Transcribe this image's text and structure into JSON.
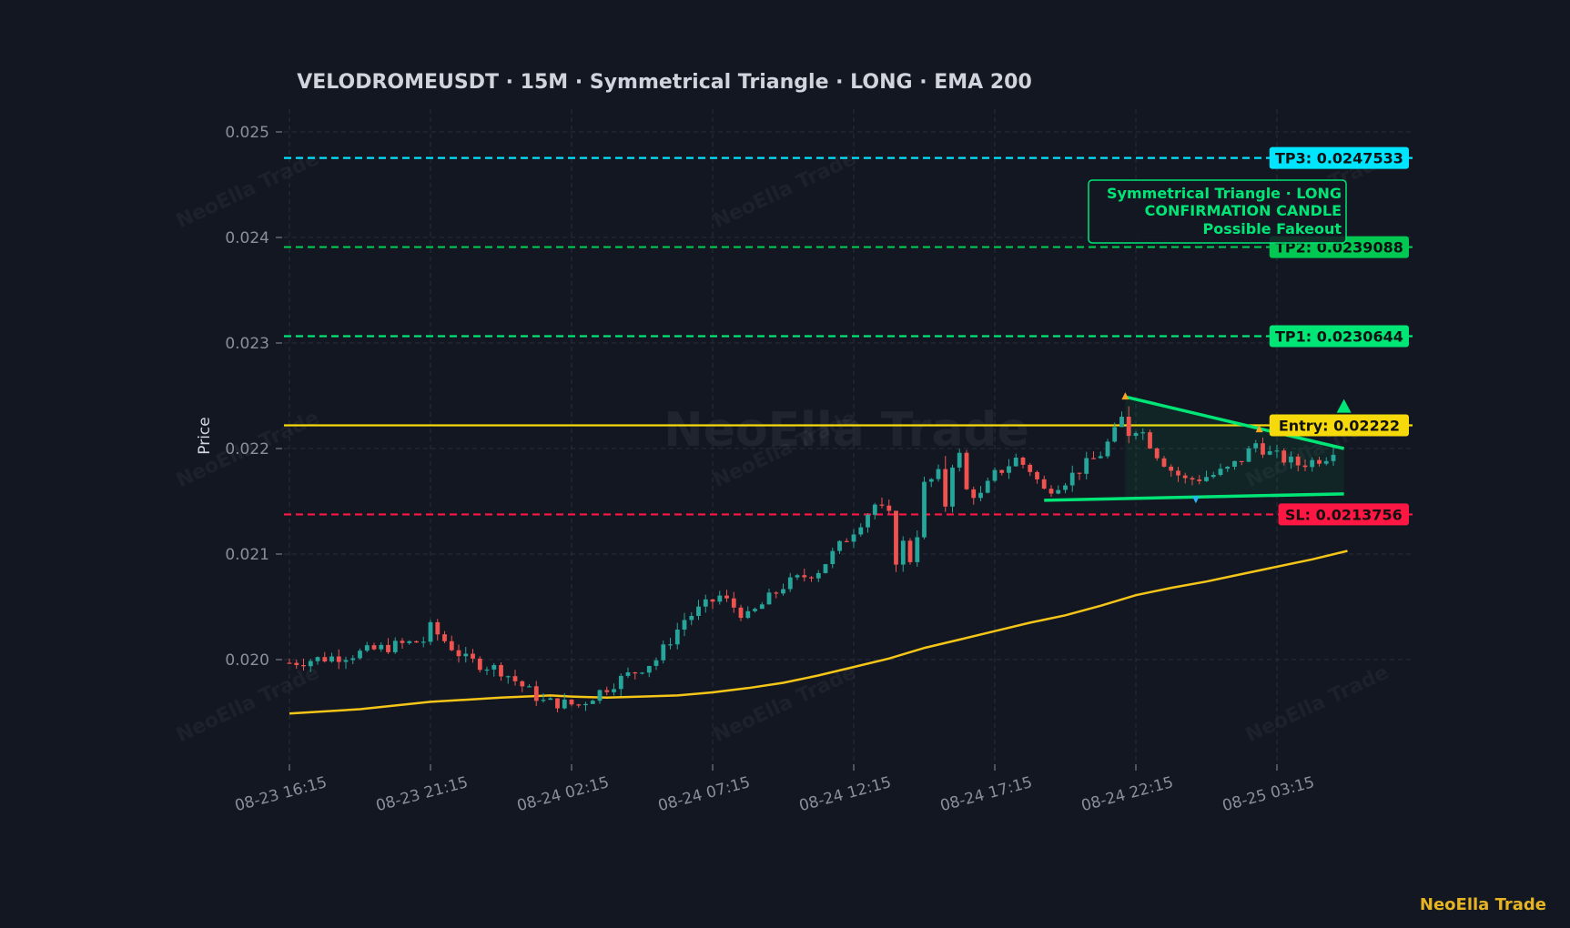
{
  "title": "VELODROMEUSDT  ·  15M  ·  Symmetrical Triangle  ·  LONG  ·  EMA 200",
  "watermark_center": "NeoElla Trade",
  "watermark_small": "NeoElla Trade",
  "brand": "NeoElla Trade",
  "colors": {
    "background": "#131722",
    "grid": "#2a2e39",
    "text": "#d1d4dc",
    "tick_text": "#8a8f9c",
    "candle_up": "#26a69a",
    "candle_down": "#ef5350",
    "ema": "#f5c518",
    "entry": "#f5d90a",
    "sl": "#ff1744",
    "tp1": "#00e676",
    "tp2": "#00c853",
    "tp3": "#00e5ff",
    "triangle": "#00e676",
    "brand": "#e6b422"
  },
  "annotation_lines": [
    "Symmetrical Triangle · LONG",
    "CONFIRMATION CANDLE",
    "Possible Fakeout"
  ],
  "chart_data": {
    "type": "candlestick",
    "title": "VELODROMEUSDT  ·  15M  ·  Symmetrical Triangle  ·  LONG  ·  EMA 200",
    "xlabel": "",
    "ylabel": "Price",
    "ylim": [
      0.0191,
      0.0252
    ],
    "yticks": [
      "0.020",
      "0.021",
      "0.022",
      "0.023",
      "0.024",
      "0.025"
    ],
    "ytick_values": [
      0.02,
      0.021,
      0.022,
      0.023,
      0.024,
      0.025
    ],
    "xticks": [
      "08-23 16:15",
      "08-23 21:15",
      "08-24 02:15",
      "08-24 07:15",
      "08-24 12:15",
      "08-24 17:15",
      "08-24 22:15",
      "08-25 03:15"
    ],
    "xtick_bar_index": [
      0,
      20,
      40,
      60,
      80,
      100,
      120,
      140
    ],
    "bar_count": 150,
    "grid": true,
    "levels": [
      {
        "name": "TP3",
        "label": "TP3: 0.0247533",
        "value": 0.0247533,
        "style": "dashed"
      },
      {
        "name": "TP2",
        "label": "TP2: 0.0239088",
        "value": 0.0239088,
        "style": "dashed"
      },
      {
        "name": "TP1",
        "label": "TP1: 0.0230644",
        "value": 0.0230644,
        "style": "dashed"
      },
      {
        "name": "Entry",
        "label": "Entry: 0.02222",
        "value": 0.02222,
        "style": "solid"
      },
      {
        "name": "SL",
        "label": "SL: 0.0213756",
        "value": 0.0213756,
        "style": "dashed"
      }
    ],
    "triangle": {
      "upper": [
        [
          118.5,
          0.02249
        ],
        [
          149.5,
          0.022
        ]
      ],
      "lower": [
        [
          107,
          0.02151
        ],
        [
          149.5,
          0.02157
        ]
      ],
      "pivot_highs": [
        [
          118.5,
          0.02249
        ],
        [
          137.5,
          0.02218
        ]
      ],
      "pivot_lows": [
        [
          128.5,
          0.02155
        ]
      ],
      "signal_bar": 149.5,
      "signal_price": 0.0224
    },
    "ema200": {
      "name": "EMA 200",
      "x": [
        0,
        10,
        20,
        30,
        37,
        40,
        45,
        50,
        55,
        60,
        65,
        70,
        75,
        80,
        85,
        90,
        95,
        100,
        105,
        110,
        115,
        120,
        125,
        130,
        135,
        140,
        145,
        150
      ],
      "y": [
        0.01949,
        0.01953,
        0.0196,
        0.01964,
        0.01966,
        0.01965,
        0.01964,
        0.01965,
        0.01966,
        0.01969,
        0.01973,
        0.01978,
        0.01985,
        0.01993,
        0.02001,
        0.02011,
        0.02019,
        0.02027,
        0.02035,
        0.02042,
        0.02051,
        0.02061,
        0.02068,
        0.02074,
        0.02081,
        0.02088,
        0.02095,
        0.02103
      ]
    },
    "anchors": [
      [
        0,
        0.01997
      ],
      [
        9,
        0.02005
      ],
      [
        14,
        0.02012
      ],
      [
        19,
        0.02018
      ],
      [
        20,
        0.0203
      ],
      [
        25,
        0.02
      ],
      [
        30,
        0.0199
      ],
      [
        36,
        0.0196
      ],
      [
        41,
        0.01957
      ],
      [
        46,
        0.01978
      ],
      [
        52,
        0.02
      ],
      [
        56,
        0.02038
      ],
      [
        61,
        0.0206
      ],
      [
        65,
        0.0204
      ],
      [
        70,
        0.0207
      ],
      [
        75,
        0.02085
      ],
      [
        79,
        0.02115
      ],
      [
        83,
        0.02147
      ],
      [
        86,
        0.0213
      ],
      [
        87,
        0.0211
      ],
      [
        88,
        0.02095
      ],
      [
        89,
        0.0212
      ],
      [
        90,
        0.02165
      ],
      [
        93,
        0.0218
      ],
      [
        95,
        0.02193
      ],
      [
        96,
        0.0216
      ],
      [
        98,
        0.02155
      ],
      [
        100,
        0.02175
      ],
      [
        103,
        0.0219
      ],
      [
        105,
        0.0218
      ],
      [
        107,
        0.0216
      ],
      [
        110,
        0.0217
      ],
      [
        112,
        0.0218
      ],
      [
        115,
        0.02195
      ],
      [
        117,
        0.02215
      ],
      [
        118,
        0.02228
      ],
      [
        119,
        0.02225
      ],
      [
        121,
        0.02215
      ],
      [
        123,
        0.02195
      ],
      [
        125,
        0.0218
      ],
      [
        127,
        0.0217
      ],
      [
        129,
        0.02172
      ],
      [
        131,
        0.02175
      ],
      [
        133,
        0.0218
      ],
      [
        135,
        0.0219
      ],
      [
        137,
        0.02205
      ],
      [
        139,
        0.02195
      ],
      [
        141,
        0.0219
      ],
      [
        143,
        0.02185
      ],
      [
        145,
        0.02188
      ],
      [
        147,
        0.02193
      ],
      [
        148,
        0.022
      ],
      [
        149,
        0.02215
      ]
    ],
    "shocks": [
      {
        "bar": 93,
        "close": 0.02145,
        "high": 0.02193,
        "low": 0.0214
      },
      {
        "bar": 86,
        "close": 0.0209,
        "high": 0.02135,
        "low": 0.02083
      },
      {
        "bar": 119,
        "close": 0.02212,
        "high": 0.0224,
        "low": 0.02205
      }
    ]
  }
}
